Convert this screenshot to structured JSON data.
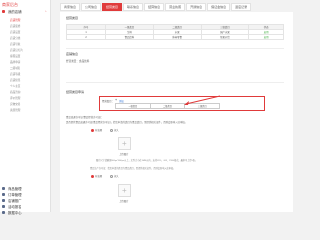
{
  "brand": "商家后台",
  "sidebar": {
    "sections": [
      {
        "label": "我的店铺",
        "active": true
      },
      {
        "label": "商品管理"
      },
      {
        "label": "订单管理"
      },
      {
        "label": "店铺推广"
      },
      {
        "label": "活动报名"
      },
      {
        "label": "数据中心"
      }
    ],
    "subitems": [
      "店铺管理",
      "店铺装修",
      "店铺设置",
      "店铺分类",
      "店铺导航",
      "店铺幻灯片",
      "客服设置",
      "品牌申请",
      "二级域名",
      "店铺等级",
      "店铺续签",
      "个人主页",
      "商品咨询",
      "评价管理",
      "实物交易",
      "资质管理"
    ]
  },
  "tabs": [
    "商家信息",
    "公司信息",
    "经营类目",
    "联系信息",
    "结算信息",
    "营业执照",
    "开通信息",
    "保证金信息",
    "退店记录"
  ],
  "category_section": {
    "title": "经营类目",
    "columns": [
      "序号",
      "一级类目",
      "二级类目",
      "三级类目",
      "状态"
    ],
    "rows": [
      [
        "1",
        "生鲜",
        "水果",
        "国产水果",
        "启用"
      ],
      [
        "2",
        "食品饮料",
        "休闲零食",
        "坚果炒货",
        "启用"
      ]
    ]
  },
  "store_section": {
    "title": "店铺信息",
    "line": "经营类目：食品饮料"
  },
  "apply_section": {
    "title": "经营类目申请",
    "box_label": "经营类目：",
    "add_plus": "+",
    "add_text": "添加",
    "inner_columns": [
      "一级类目",
      "二级类目",
      "三级类目"
    ],
    "form_lines": [
      "食品流通许可证(食品经营许可证)：",
      "是否提供食品流通许可证(食品经营许可证)，若您申请的类目为食品类目，需提供相关证件，否则会影响入驻审核。"
    ],
    "radio_yes": "有效期",
    "radio_no": "永久",
    "upload_label": "上传图片",
    "note1": "图片尺寸请确保800px*800px以上，文件大小在1MB以内，支持JPG、GIF、PNG格式，最多可上传5张。",
    "note2": "食品生产许可证：若您申请的类目为食品类目，需提供相关证件，否则会影响入驻审核。"
  }
}
